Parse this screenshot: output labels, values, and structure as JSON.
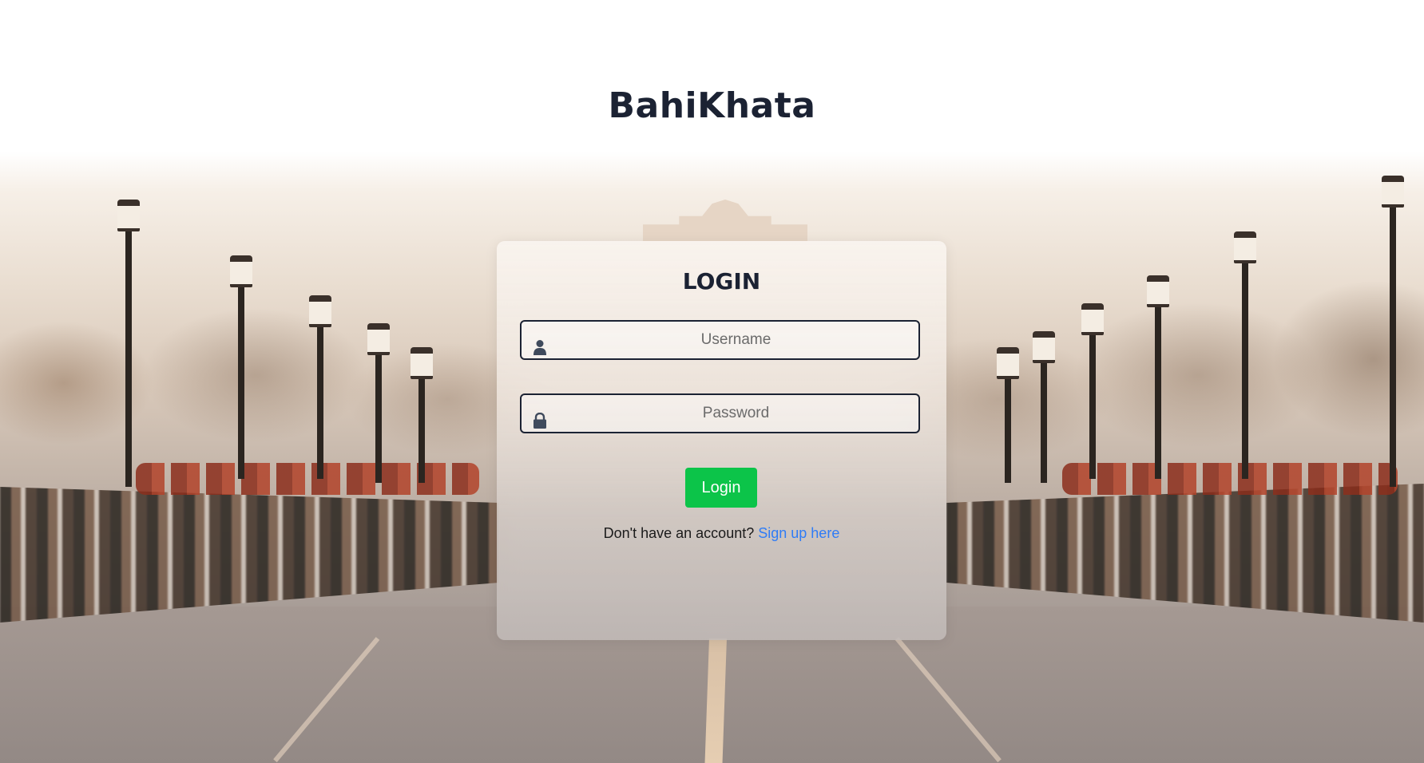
{
  "app": {
    "title": "BahiKhata"
  },
  "login_card": {
    "heading": "LOGIN",
    "username_field": {
      "placeholder": "Username",
      "value": "",
      "icon": "user-icon"
    },
    "password_field": {
      "placeholder": "Password",
      "value": "",
      "icon": "lock-icon"
    },
    "submit_label": "Login",
    "signup_prompt": "Don't have an account?",
    "signup_link": "Sign up here"
  },
  "colors": {
    "title_text": "#1b2233",
    "login_button": "#0cc449",
    "link": "#2f7cf6",
    "field_border": "#1b2233"
  }
}
